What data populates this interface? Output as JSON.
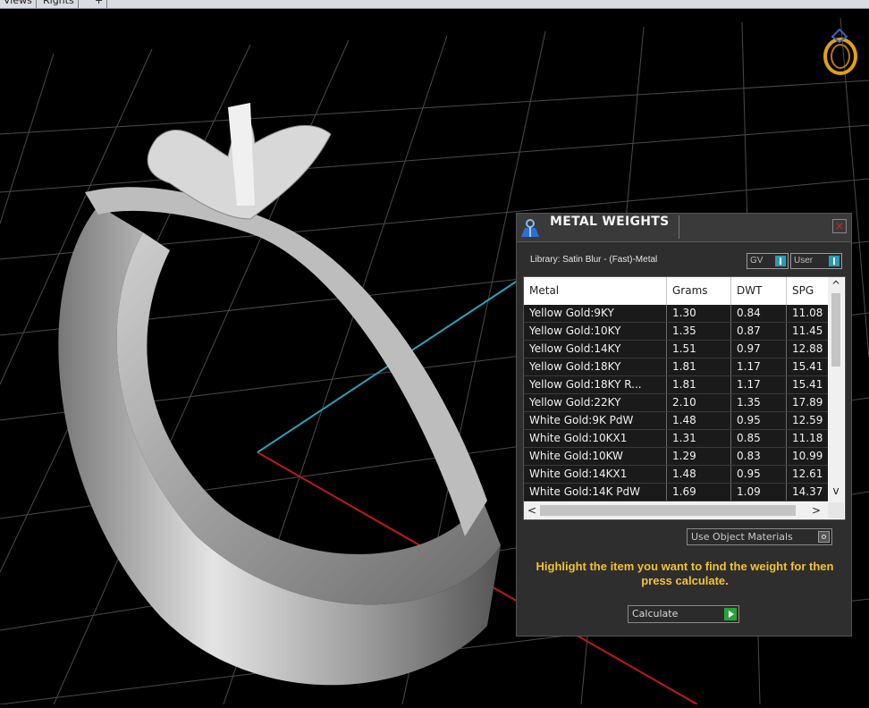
{
  "topbar": {
    "tabs": [
      "Views",
      "Rights",
      "+"
    ]
  },
  "panel": {
    "title": "METAL WEIGHTS",
    "close_label": "×",
    "library": "Library: Satin Blur - (Fast)-Metal",
    "toggle_gv": "GV",
    "toggle_user": "User",
    "columns": [
      "Metal",
      "Grams",
      "DWT",
      "SPG"
    ],
    "rows": [
      {
        "metal": "Yellow Gold:9KY",
        "grams": "1.30",
        "dwt": "0.84",
        "spg": "11.08"
      },
      {
        "metal": "Yellow Gold:10KY",
        "grams": "1.35",
        "dwt": "0.87",
        "spg": "11.45"
      },
      {
        "metal": "Yellow Gold:14KY",
        "grams": "1.51",
        "dwt": "0.97",
        "spg": "12.88"
      },
      {
        "metal": "Yellow Gold:18KY",
        "grams": "1.81",
        "dwt": "1.17",
        "spg": "15.41"
      },
      {
        "metal": "Yellow Gold:18KY R...",
        "grams": "1.81",
        "dwt": "1.17",
        "spg": "15.41"
      },
      {
        "metal": "Yellow Gold:22KY",
        "grams": "2.10",
        "dwt": "1.35",
        "spg": "17.89"
      },
      {
        "metal": "White Gold:9K PdW",
        "grams": "1.48",
        "dwt": "0.95",
        "spg": "12.59"
      },
      {
        "metal": "White Gold:10KX1",
        "grams": "1.31",
        "dwt": "0.85",
        "spg": "11.18"
      },
      {
        "metal": "White Gold:10KW",
        "grams": "1.29",
        "dwt": "0.83",
        "spg": "10.99"
      },
      {
        "metal": "White Gold:14KX1",
        "grams": "1.48",
        "dwt": "0.95",
        "spg": "12.61"
      },
      {
        "metal": "White Gold:14K PdW",
        "grams": "1.69",
        "dwt": "1.09",
        "spg": "14.37"
      }
    ],
    "use_object_materials": "Use Object Materials",
    "hint": "Highlight the item you want to find the weight for then press calculate.",
    "calculate_label": "Calculate"
  },
  "colors": {
    "hint": "#f1c232",
    "toggle_accent": "#2a9bb4",
    "go_button": "#27a33a",
    "x_axis": "#c01818",
    "y_axis": "#2aa0b8"
  }
}
